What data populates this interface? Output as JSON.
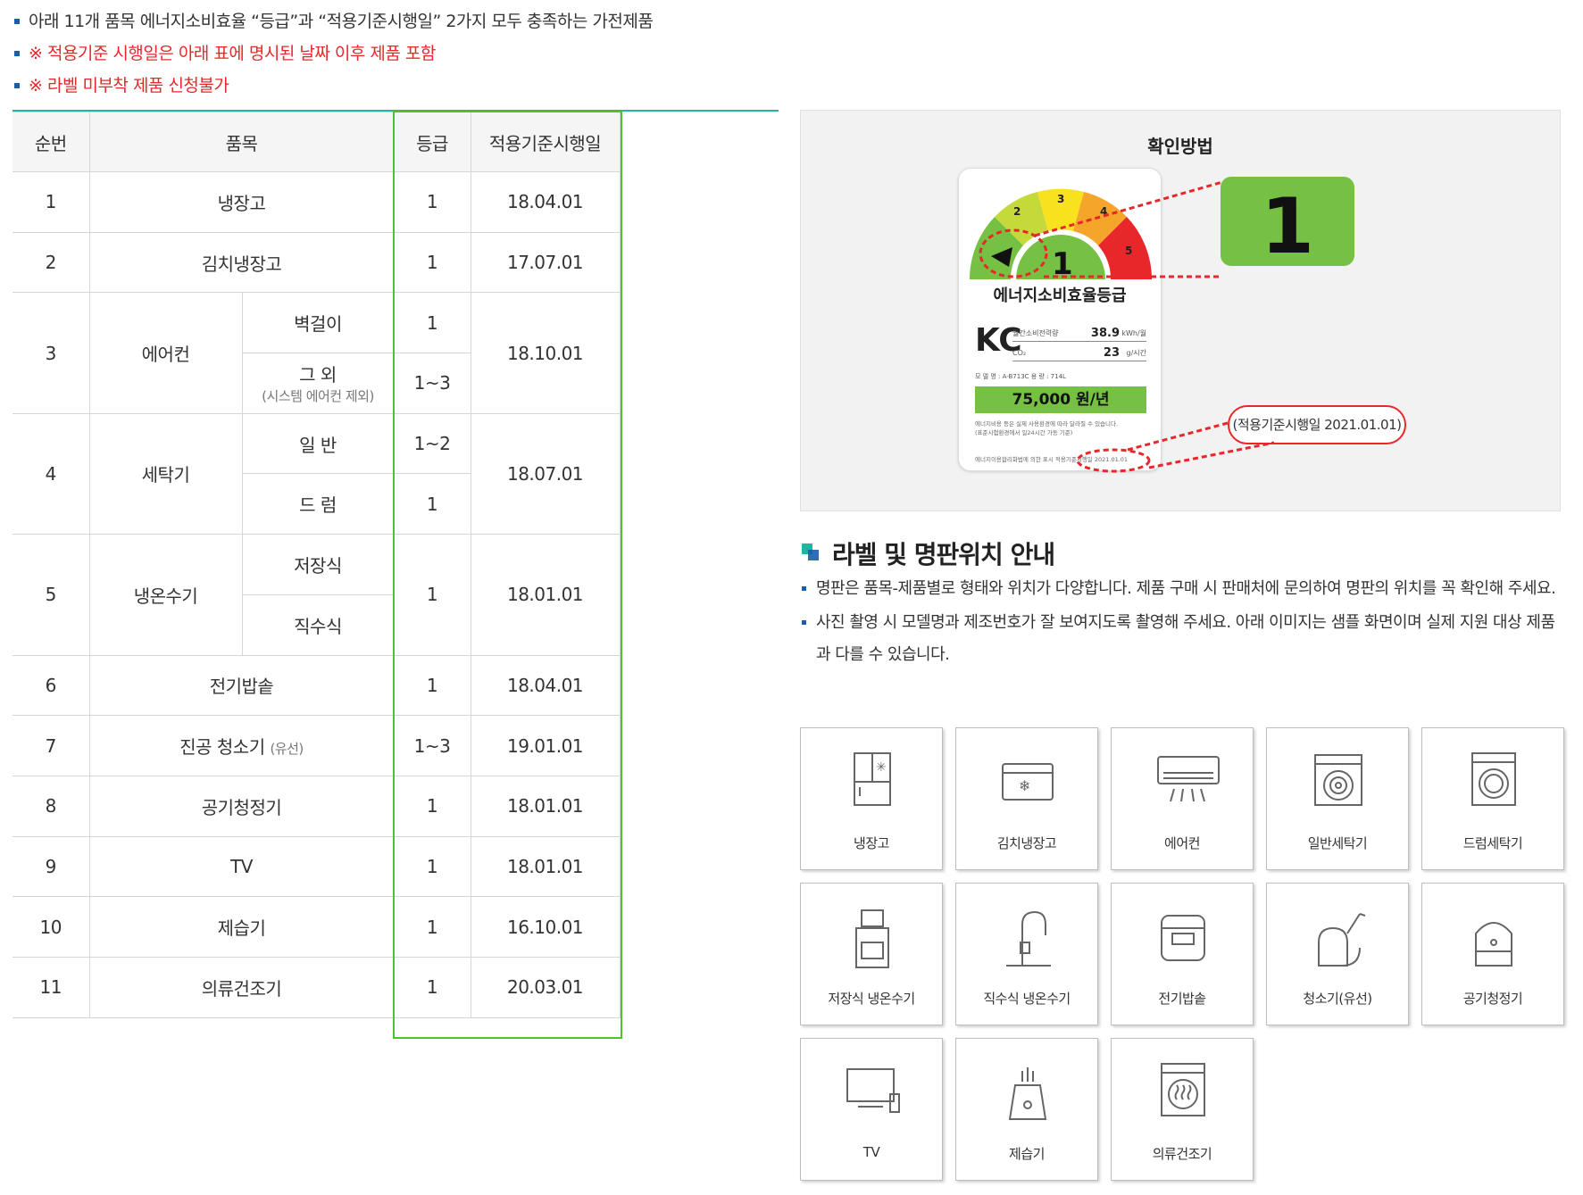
{
  "notes": [
    {
      "text": "아래 11개 품목 에너지소비효율 “등급”과 “적용기준시행일” 2가지 모두 충족하는 가전제품",
      "color": "#333333"
    },
    {
      "text": "※ 적용기준 시행일은 아래 표에 명시된 날짜 이후 제품 포함",
      "color": "#e8272a"
    },
    {
      "text": "※ 라벨 미부착 제품 신청불가",
      "color": "#e8272a"
    }
  ],
  "table": {
    "headers": {
      "no": "순번",
      "item": "품목",
      "grade": "등급",
      "date": "적용기준시행일"
    },
    "rows": [
      {
        "no": "1",
        "item": "냉장고",
        "grade": "1",
        "date": "18.04.01"
      },
      {
        "no": "2",
        "item": "김치냉장고",
        "grade": "1",
        "date": "17.07.01"
      },
      {
        "no": "3",
        "item": "에어컨",
        "sub": [
          {
            "name": "벽걸이",
            "grade": "1"
          },
          {
            "name": "그 외",
            "note": "(시스템 에어컨 제외)",
            "grade": "1~3"
          }
        ],
        "date": "18.10.01"
      },
      {
        "no": "4",
        "item": "세탁기",
        "sub": [
          {
            "name": "일 반",
            "grade": "1~2"
          },
          {
            "name": "드 럼",
            "grade": "1"
          }
        ],
        "date": "18.07.01"
      },
      {
        "no": "5",
        "item": "냉온수기",
        "sub": [
          {
            "name": "저장식"
          },
          {
            "name": "직수식"
          }
        ],
        "grade": "1",
        "date": "18.01.01"
      },
      {
        "no": "6",
        "item": "전기밥솥",
        "grade": "1",
        "date": "18.04.01"
      },
      {
        "no": "7",
        "item": "진공 청소기",
        "item_note": "(유선)",
        "grade": "1~3",
        "date": "19.01.01"
      },
      {
        "no": "8",
        "item": "공기청정기",
        "grade": "1",
        "date": "18.01.01"
      },
      {
        "no": "9",
        "item": "TV",
        "grade": "1",
        "date": "18.01.01"
      },
      {
        "no": "10",
        "item": "제습기",
        "grade": "1",
        "date": "16.10.01"
      },
      {
        "no": "11",
        "item": "의류건조기",
        "grade": "1",
        "date": "20.03.01"
      }
    ]
  },
  "check": {
    "title": "확인방법",
    "label": {
      "grade": "1",
      "heading": "에너지소비효율등급",
      "kc": "KC",
      "monthly_power_label": "월간소비전력량",
      "monthly_power": "38.9",
      "monthly_power_unit": "kWh/월",
      "co2_label": "CO₂",
      "co2": "23",
      "co2_unit": "g/시간",
      "model": "모 델 명 : A-B713C   용 량 : 714L",
      "annual_cost": "75,000 원/년",
      "fine_1": "에너지비용 등은 실제 사용환경에 따라 달라질 수 있습니다.",
      "fine_2": "(표준시험환경에서 일24시간 가동 기준)",
      "footer": "에너지이용합리화법에 의한 표시 적용기준시행일 2021.01.01"
    },
    "badge_grade": "1",
    "date_callout": "(적용기준시행일 2021.01.01)",
    "gauge_numbers": [
      "2",
      "3",
      "4",
      "5"
    ],
    "colors": {
      "green": "#76c043",
      "yellow_green": "#c5d93a",
      "yellow": "#f7e21d",
      "orange": "#f6a52b",
      "red": "#e8272a",
      "callout": "#e8272a"
    }
  },
  "guide": {
    "heading": "라벨 및 명판위치 안내",
    "texts": [
      "명판은 품목-제품별로 형태와 위치가 다양합니다. 제품 구매 시 판매처에 문의하여 명판의 위치를 꼭 확인해 주세요.",
      "사진 촬영 시 모델명과 제조번호가 잘 보여지도록 촬영해 주세요. 아래 이미지는 샘플 화면이며 실제 지원 대상 제품과 다를 수 있습니다."
    ]
  },
  "tiles": [
    {
      "label": "냉장고",
      "icon": "refrigerator-icon"
    },
    {
      "label": "김치냉장고",
      "icon": "kimchi-fridge-icon"
    },
    {
      "label": "에어컨",
      "icon": "air-conditioner-icon"
    },
    {
      "label": "일반세탁기",
      "icon": "top-loader-washer-icon"
    },
    {
      "label": "드럼세탁기",
      "icon": "drum-washer-icon"
    },
    {
      "label": "저장식 냉온수기",
      "icon": "water-dispenser-icon"
    },
    {
      "label": "직수식 냉온수기",
      "icon": "faucet-icon"
    },
    {
      "label": "전기밥솥",
      "icon": "rice-cooker-icon"
    },
    {
      "label": "청소기(유선)",
      "icon": "vacuum-cleaner-icon"
    },
    {
      "label": "공기청정기",
      "icon": "air-purifier-icon"
    },
    {
      "label": "TV",
      "icon": "tv-icon"
    },
    {
      "label": "제습기",
      "icon": "dehumidifier-icon"
    },
    {
      "label": "의류건조기",
      "icon": "clothes-dryer-icon"
    }
  ]
}
